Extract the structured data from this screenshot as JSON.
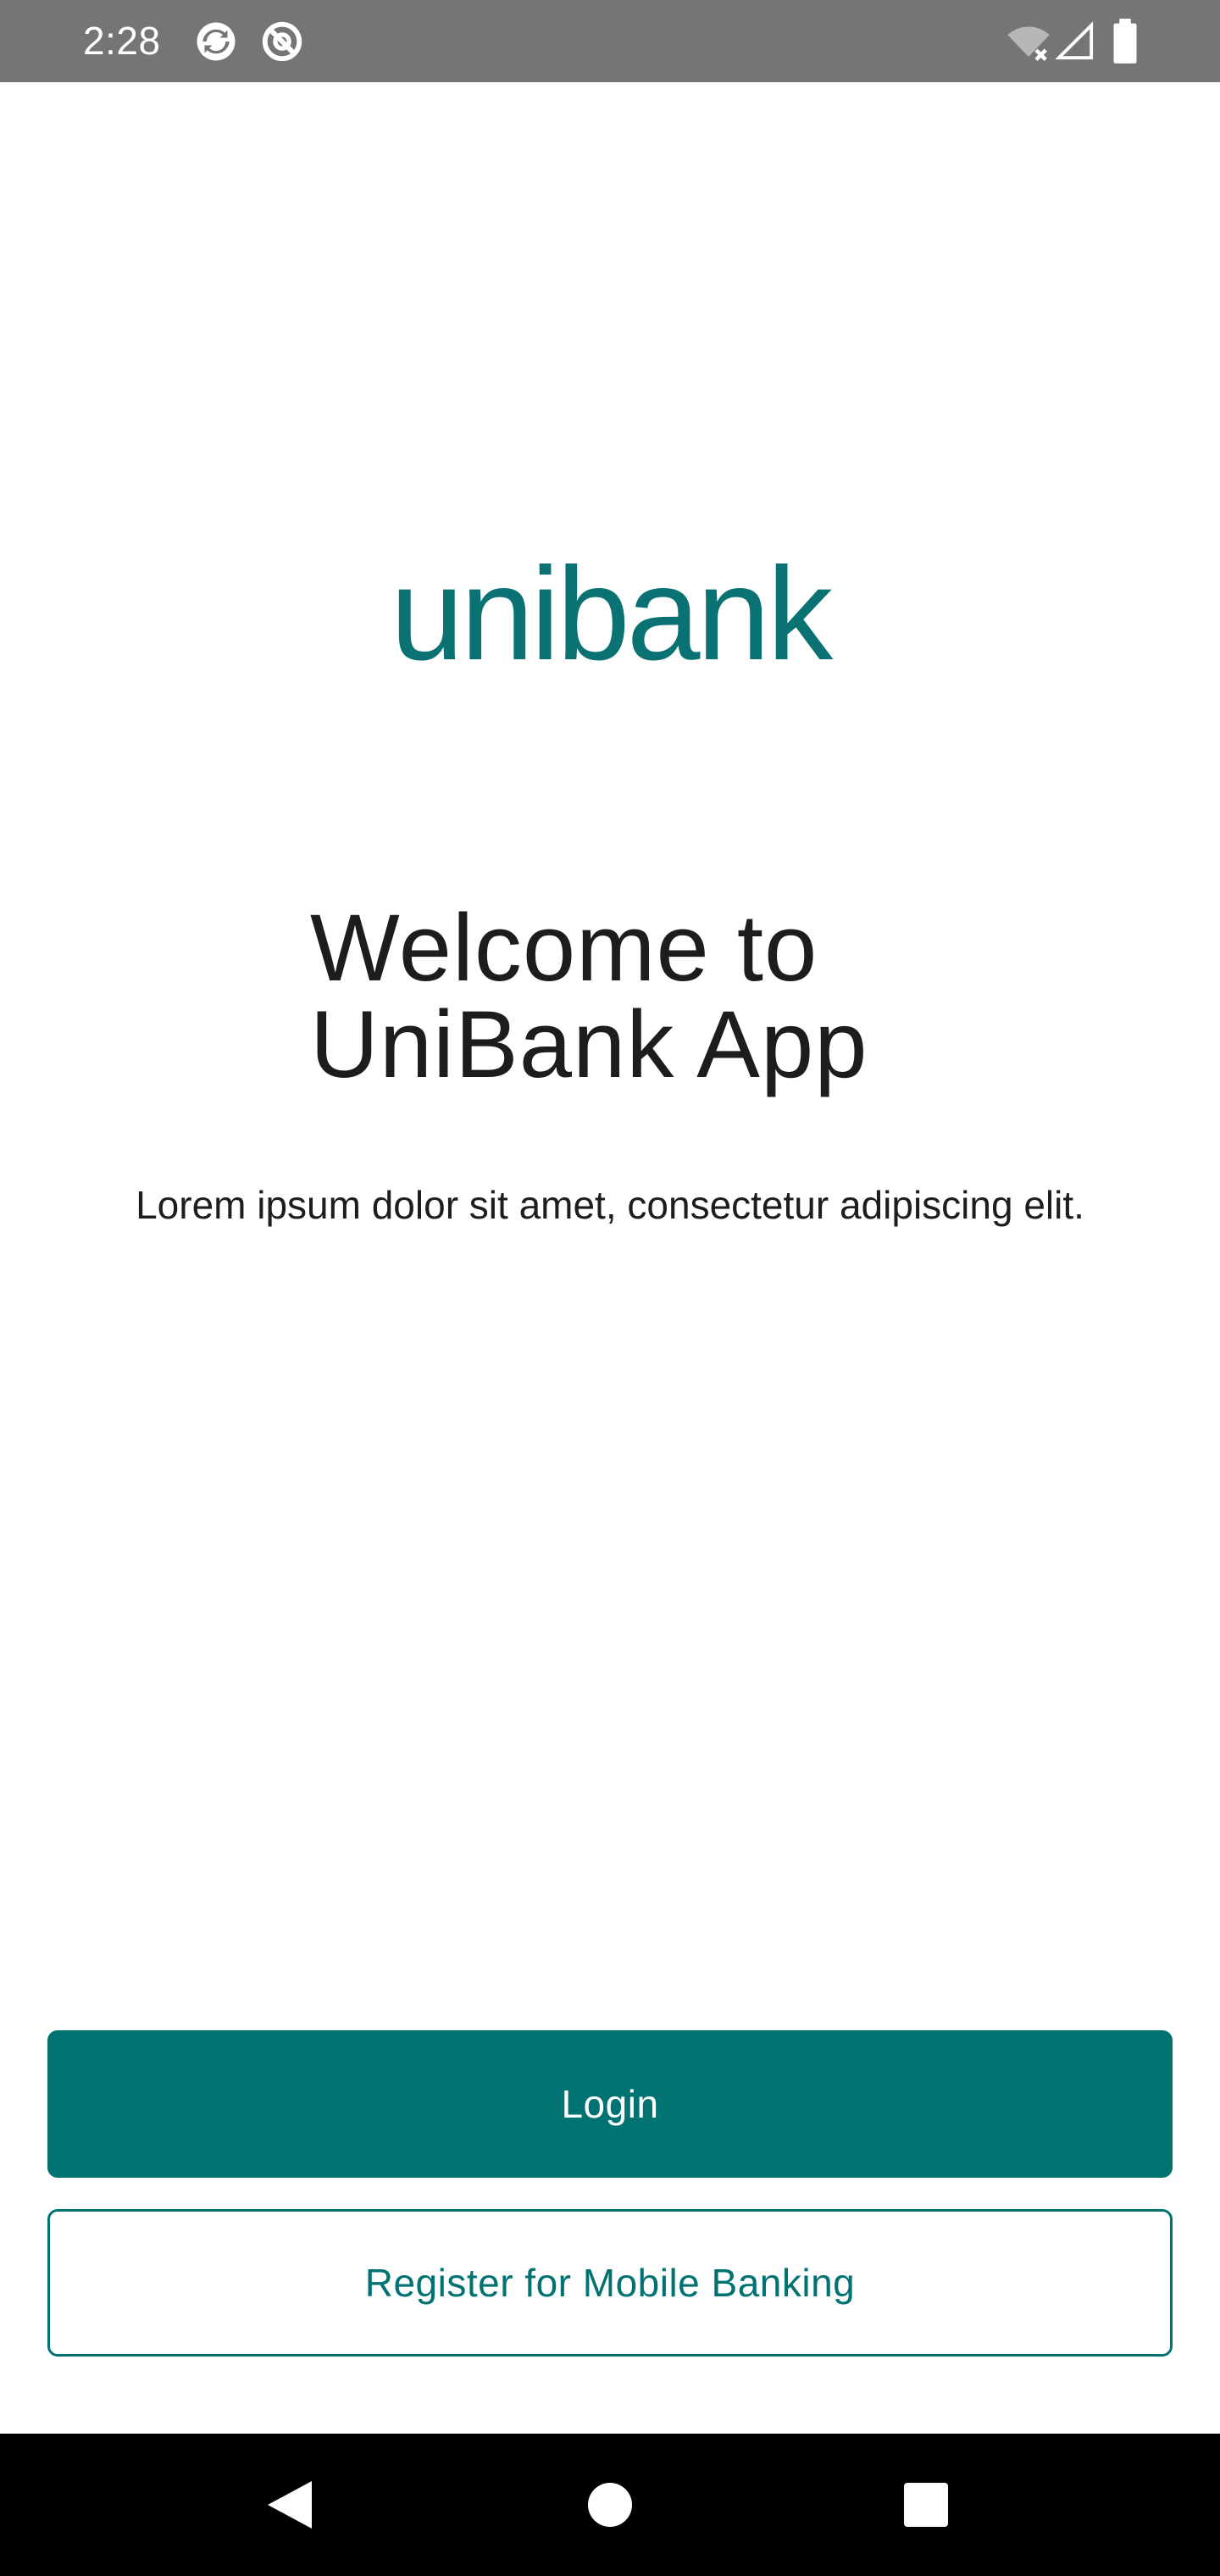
{
  "status_bar": {
    "time": "2:28",
    "icons": [
      "sync-notification-icon",
      "data-saver-notification-icon",
      "wifi-off-icon",
      "cellular-signal-icon",
      "battery-icon"
    ],
    "background_color": "#757575"
  },
  "logo": {
    "text": "unibank",
    "color": "#0b7274"
  },
  "welcome": {
    "title_line1": "Welcome to",
    "title_line2": "UniBank App",
    "subtitle": "Lorem ipsum dolor sit amet, consectetur adipiscing elit."
  },
  "actions": {
    "login_label": "Login",
    "register_label": "Register for Mobile Banking",
    "accent_color": "#007272"
  },
  "nav_bar": {
    "icons": [
      "back-icon",
      "home-icon",
      "recents-icon"
    ]
  }
}
